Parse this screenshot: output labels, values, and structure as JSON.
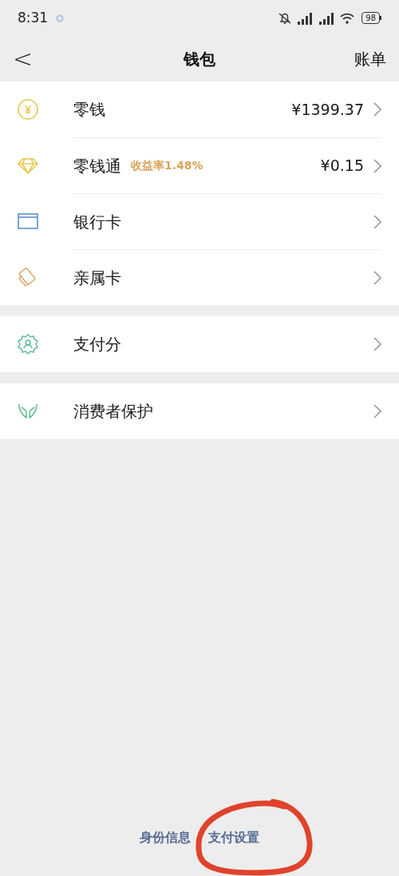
{
  "status_bar": {
    "time": "8:31",
    "battery": "98"
  },
  "nav": {
    "back": "<",
    "title": "钱包",
    "action": "账单"
  },
  "groups": [
    {
      "items": [
        {
          "label": "零钱",
          "value": "¥1399.37"
        },
        {
          "label": "零钱通",
          "badge": "收益率1.48%",
          "value": "¥0.15"
        },
        {
          "label": "银行卡"
        },
        {
          "label": "亲属卡"
        }
      ]
    },
    {
      "items": [
        {
          "label": "支付分"
        }
      ]
    },
    {
      "items": [
        {
          "label": "消费者保护"
        }
      ]
    }
  ],
  "footer_links": [
    "身份信息",
    "支付设置"
  ]
}
